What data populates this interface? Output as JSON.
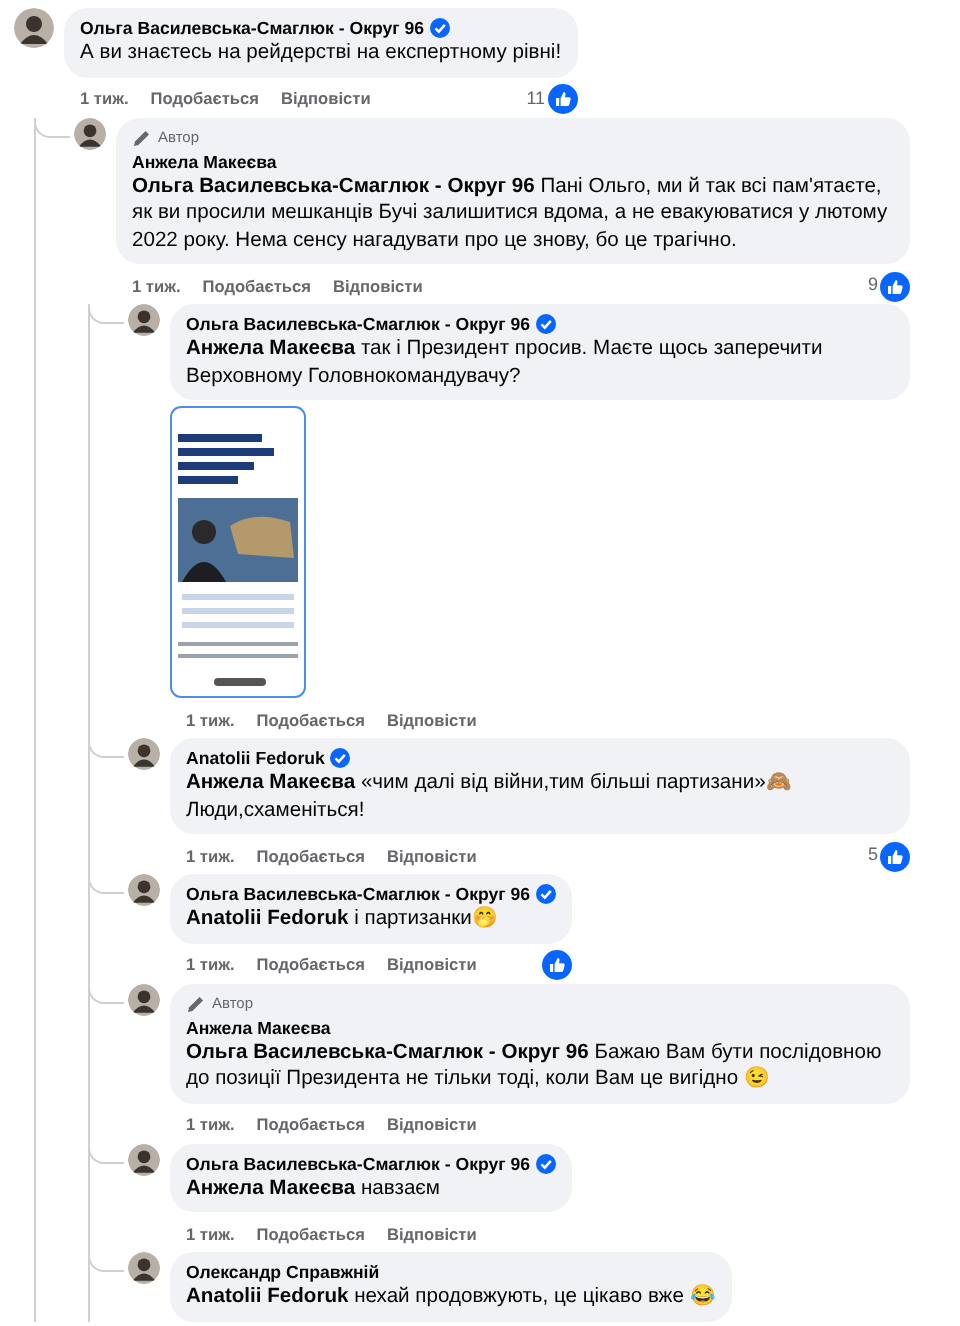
{
  "comments": [
    {
      "author": "Ольга Василевська-Смаглюк - Округ 96",
      "verified": true,
      "text": "А ви знаєтесь на рейдерстві на експертному рівні!",
      "time": "1 тиж.",
      "like_label": "Подобається",
      "reply_label": "Відповісти",
      "reaction_icon": true,
      "reaction_count": "11",
      "replies": [
        {
          "author_badge": "Автор",
          "author": "Анжела Макеєва",
          "verified": false,
          "text": "**Ольга Василевська-Смаглюк - Округ 96** Пані Ольго, ми й так всі пам'ятаєте, як ви просили мешканців Бучі залишитися вдома, а не евакуюватися у лютому 2022 року. Нема сенсу нагадувати про це знову, бо це трагічно.",
          "time": "1 тиж.",
          "like_label": "Подобається",
          "reply_label": "Відповісти",
          "reaction_icon": true,
          "reaction_count": "9",
          "replies": [
            {
              "author": "Ольга Василевська-Смаглюк - Округ 96",
              "verified": true,
              "text": "**Анжела Макеєва** так і Президент просив. Маєте щось заперечити Верховному Головнокомандувачу?",
              "time": "1 тиж.",
              "like_label": "Подобається",
              "reply_label": "Відповісти",
              "reaction_icon": false
            },
            {
              "author": "Anatolii Fedoruk",
              "verified": true,
              "text": "**Анжела Макеєва** «чим далі від війни,тим більші партизани»🙈 Люди,схаменіться!",
              "time": "1 тиж.",
              "like_label": "Подобається",
              "reply_label": "Відповісти",
              "reaction_icon": true,
              "reaction_count": "5"
            },
            {
              "author": "Ольга Василевська-Смаглюк - Округ 96",
              "verified": true,
              "text": "**Anatolii Fedoruk** і партизанки🤭",
              "time": "1 тиж.",
              "like_label": "Подобається",
              "reply_label": "Відповісти",
              "reaction_icon": true
            },
            {
              "author_badge": "Автор",
              "author": "Анжела Макеєва",
              "verified": false,
              "text": "**Ольга Василевська-Смаглюк - Округ 96** Бажаю Вам бути послідовною до позиції Президента не тільки тоді, коли Вам це вигідно 😉",
              "time": "1 тиж.",
              "like_label": "Подобається",
              "reply_label": "Відповісти",
              "reaction_icon": false
            },
            {
              "author": "Ольга Василевська-Смаглюк - Округ 96",
              "verified": true,
              "text": "**Анжела Макеєва** навзаєм",
              "time": "1 тиж.",
              "like_label": "Подобається",
              "reply_label": "Відповісти",
              "reaction_icon": false
            },
            {
              "author": "Олександр Справжній",
              "verified": false,
              "text": "**Anatolii Fedoruk** нехай продовжують, це цікаво вже 😂",
              "reaction_icon": false
            }
          ]
        }
      ]
    }
  ]
}
